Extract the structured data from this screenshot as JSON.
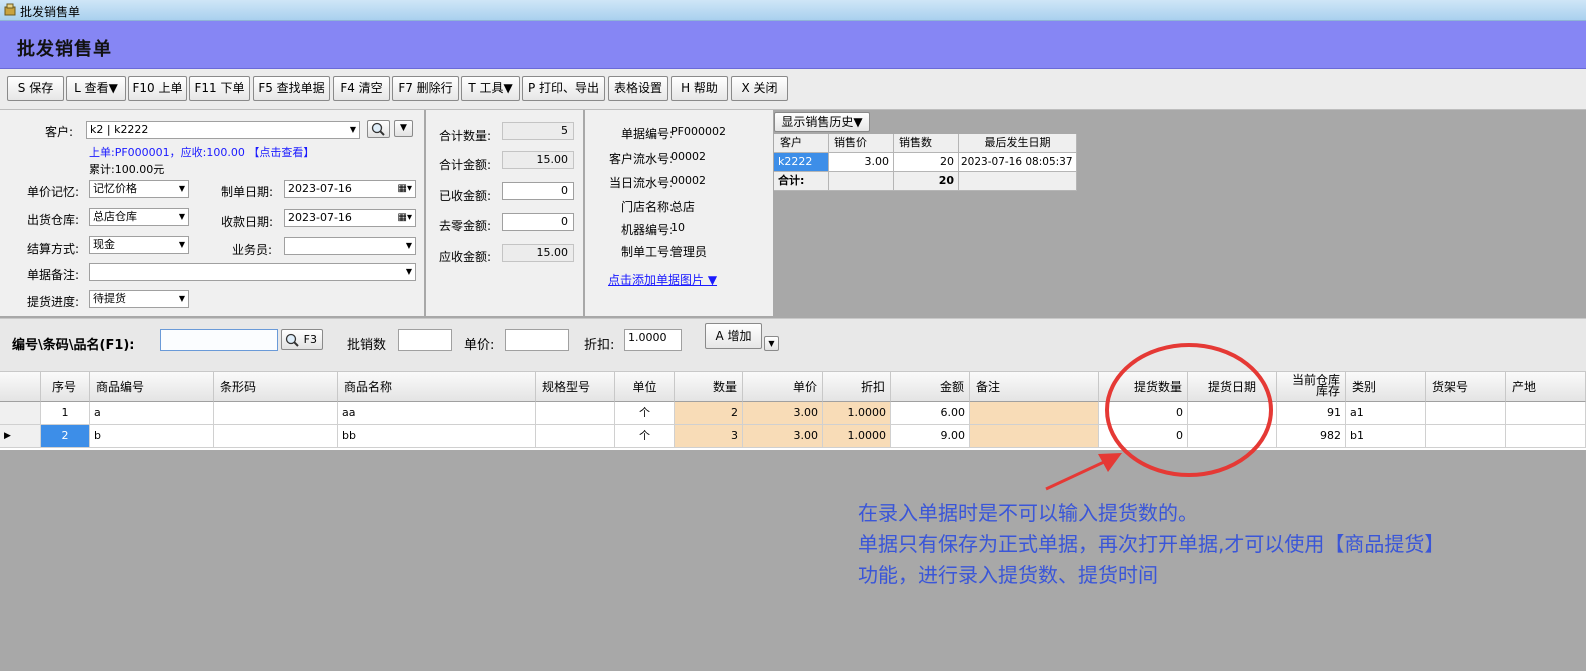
{
  "window": {
    "title": "批发销售单"
  },
  "page_title": "批发销售单",
  "toolbar": {
    "save": "S 保存",
    "view": "L 查看▼",
    "prev": "F10 上单",
    "next": "F11 下单",
    "find": "F5 查找单据",
    "clear": "F4 清空",
    "delrow": "F7 删除行",
    "tools": "T 工具▼",
    "print": "P 打印、导出",
    "table_settings": "表格设置",
    "help": "H 帮助",
    "close": "X 关闭"
  },
  "form": {
    "customer_label": "客户:",
    "customer_value": "k2 | k2222",
    "last_order_text": "上单:PF000001，应收:100.00",
    "last_order_link": "【点击查看】",
    "cumulative": "累计:100.00元",
    "price_memory_label": "单价记忆:",
    "price_memory_value": "记忆价格",
    "warehouse_label": "出货仓库:",
    "warehouse_value": "总店仓库",
    "settle_label": "结算方式:",
    "settle_value": "现金",
    "remark_label": "单据备注:",
    "remark_value": "",
    "progress_label": "提货进度:",
    "progress_value": "待提货",
    "date_label": "制单日期:",
    "date_value": "2023-07-16",
    "receive_date_label": "收款日期:",
    "receive_date_value": "2023-07-16",
    "salesman_label": "业务员:",
    "salesman_value": ""
  },
  "totals": {
    "qty_label": "合计数量:",
    "qty": "5",
    "amount_label": "合计金额:",
    "amount": "15.00",
    "received_label": "已收金额:",
    "received": "0",
    "rounding_label": "去零金额:",
    "rounding": "0",
    "due_label": "应收金额:",
    "due": "15.00"
  },
  "info": {
    "doc_no_label": "单据编号:",
    "doc_no": "PF000002",
    "cust_serial_label": "客户流水号:",
    "cust_serial": "00002",
    "day_serial_label": "当日流水号:",
    "day_serial": "00002",
    "store_label": "门店名称:",
    "store": "总店",
    "machine_label": "机器编号:",
    "machine": "10",
    "operator_label": "制单工号:",
    "operator": "管理员",
    "add_image_link": "点击添加单据图片 ▼"
  },
  "history": {
    "toggle": "显示销售历史▼",
    "headers": [
      "客户",
      "销售价",
      "销售数",
      "最后发生日期"
    ],
    "rows": [
      [
        "k2222",
        "3.00",
        "20",
        "2023-07-16 08:05:37"
      ]
    ],
    "total_label": "合计:",
    "total_qty": "20"
  },
  "entry": {
    "code_label": "编号\\条码\\品名(F1):",
    "code_value": "",
    "search_button": "F3",
    "qty_label": "批销数",
    "qty_value": "",
    "price_label": "单价:",
    "price_value": "",
    "discount_label": "折扣:",
    "discount_value": "1.0000",
    "add_button": "A 增加"
  },
  "grid": {
    "headers": [
      "序号",
      "商品编号",
      "条形码",
      "商品名称",
      "规格型号",
      "单位",
      "数量",
      "单价",
      "折扣",
      "金额",
      "备注",
      "提货数量",
      "提货日期",
      "当前仓库库存",
      "类别",
      "货架号",
      "产地"
    ],
    "stock_header_line1": "当前仓库",
    "stock_header_line2": "库存",
    "rows": [
      [
        "1",
        "a",
        "",
        "aa",
        "",
        "个",
        "2",
        "3.00",
        "1.0000",
        "6.00",
        "",
        "0",
        "",
        "91",
        "a1",
        "",
        ""
      ],
      [
        "2",
        "b",
        "",
        "bb",
        "",
        "个",
        "3",
        "3.00",
        "1.0000",
        "9.00",
        "",
        "0",
        "",
        "982",
        "b1",
        "",
        ""
      ]
    ]
  },
  "annotation": {
    "line1": "在录入单据时是不可以输入提货数的。",
    "line2": "单据只有保存为正式单据，再次打开单据,才可以使用【商品提货】",
    "line3": "功能，进行录入提货数、提货时间"
  },
  "colors": {
    "header_band": "#8686f4",
    "link": "#1a1aff",
    "peach": "#f8dcb7",
    "annotation": "#3a56d8",
    "ellipse": "#e53935"
  }
}
